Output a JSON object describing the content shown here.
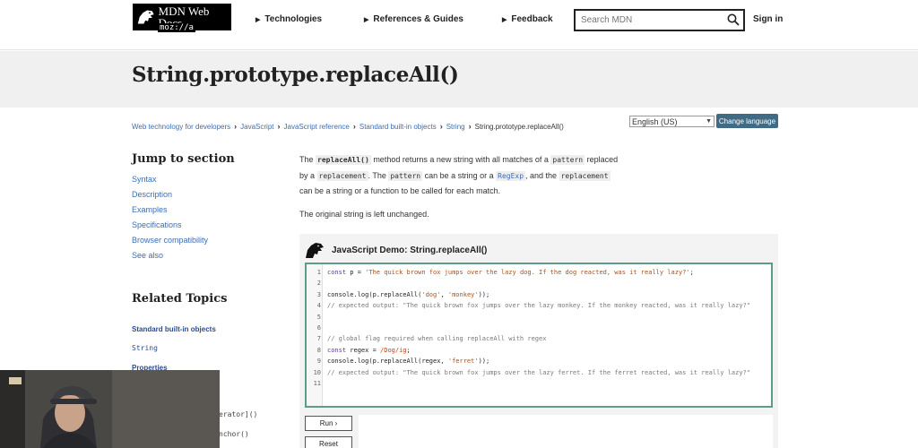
{
  "header": {
    "logo_text": "MDN Web Docs",
    "logo_sub": "moz://a",
    "nav": [
      {
        "label": "Technologies"
      },
      {
        "label": "References & Guides"
      },
      {
        "label": "Feedback"
      }
    ],
    "search_placeholder": "Search MDN",
    "sign_in": "Sign in"
  },
  "page": {
    "title": "String.prototype.replaceAll()"
  },
  "breadcrumb": [
    "Web technology for developers",
    "JavaScript",
    "JavaScript reference",
    "Standard built-in objects",
    "String",
    "String.prototype.replaceAll()"
  ],
  "language": {
    "selected": "English (US)",
    "button": "Change language"
  },
  "sidebar": {
    "jump_heading": "Jump to section",
    "jump_links": [
      "Syntax",
      "Description",
      "Examples",
      "Specifications",
      "Browser compatibility",
      "See also"
    ],
    "related_heading": "Related Topics",
    "related_links": [
      "Standard built-in objects",
      "String",
      "Properties"
    ],
    "partial_items": [
      "erator]()",
      "nchor()"
    ]
  },
  "intro": {
    "p1_a": "The ",
    "p1_code1": "replaceAll()",
    "p1_b": " method returns a new string with all matches of a ",
    "p1_code2": "pattern",
    "p1_c": " replaced by a ",
    "p1_code3": "replacement",
    "p1_d": ". The ",
    "p1_code4": "pattern",
    "p1_e": " can be a string or a ",
    "p1_code5": "RegExp",
    "p1_f": ", and the ",
    "p1_code6": "replacement",
    "p1_g": " can be a string or a function to be called for each match.",
    "p2": "The original string is left unchanged."
  },
  "demo": {
    "title": "JavaScript Demo: String.replaceAll()",
    "lines": [
      {
        "n": "1",
        "kw": "const",
        "rest": " p = ",
        "str": "'The quick brown fox jumps over the lazy dog. If the dog reacted, was it really lazy?'",
        "end": ";"
      },
      {
        "n": "2",
        "blank": true
      },
      {
        "n": "3",
        "plain": "console.log(p.replaceAll(",
        "str": "'dog'",
        "mid": ", ",
        "str2": "'monkey'",
        "end": "));"
      },
      {
        "n": "4",
        "comment": "// expected output: \"The quick brown fox jumps over the lazy monkey. If the monkey reacted, was it really lazy?\""
      },
      {
        "n": "5",
        "blank": true
      },
      {
        "n": "6",
        "blank": true
      },
      {
        "n": "7",
        "comment": "// global flag required when calling replaceAll with regex"
      },
      {
        "n": "8",
        "kw": "const",
        "rest": " regex = ",
        "re": "/Dog/ig",
        "end": ";"
      },
      {
        "n": "9",
        "plain": "console.log(p.replaceAll(regex, ",
        "str": "'ferret'",
        "end": "));"
      },
      {
        "n": "10",
        "comment": "// expected output: \"The quick brown fox jumps over the lazy ferret. If the ferret reacted, was it really lazy?\""
      },
      {
        "n": "11",
        "blank": true
      }
    ],
    "run_label": "Run ›",
    "reset_label": "Reset"
  },
  "colors": {
    "accent": "#3f6b85",
    "link": "#3d6db5",
    "editor_border": "#5d9c8b"
  }
}
